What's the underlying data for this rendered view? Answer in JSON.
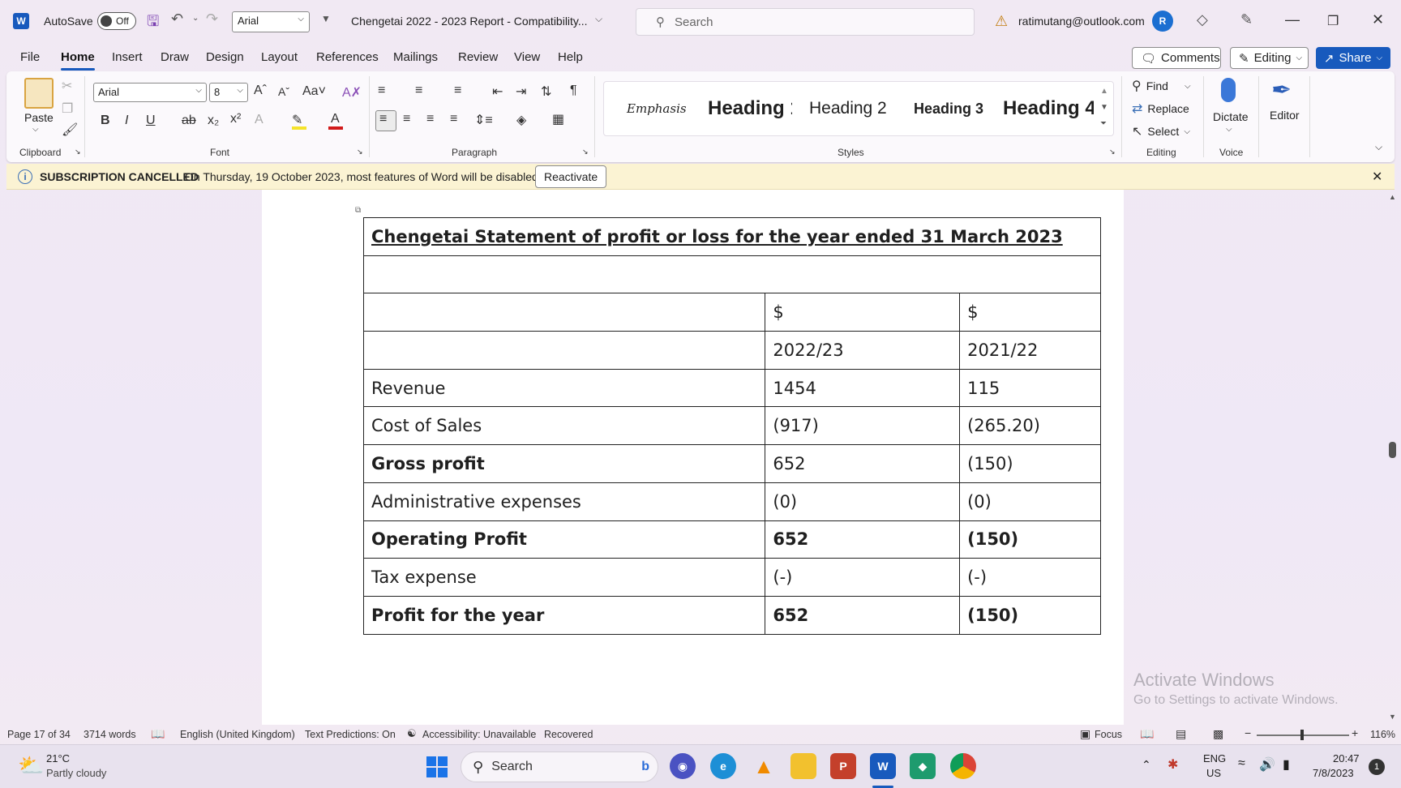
{
  "titlebar": {
    "app_letter": "W",
    "autosave_label": "AutoSave",
    "autosave_state": "Off",
    "font_name": "Arial",
    "document_title": "Chengetai 2022 - 2023 Report  -  Compatibility...",
    "search_placeholder": "Search",
    "account_email": "ratimutang@outlook.com",
    "avatar_initial": "R"
  },
  "tabs": [
    "File",
    "Home",
    "Insert",
    "Draw",
    "Design",
    "Layout",
    "References",
    "Mailings",
    "Review",
    "View",
    "Help"
  ],
  "tab_actions": {
    "comments": "Comments",
    "editing": "Editing",
    "share": "Share"
  },
  "ribbon": {
    "clipboard": {
      "paste": "Paste",
      "label": "Clipboard"
    },
    "font": {
      "family": "Arial",
      "size": "8",
      "label": "Font"
    },
    "paragraph": {
      "label": "Paragraph"
    },
    "styles": {
      "label": "Styles",
      "items": [
        "Emphasis",
        "Heading 1",
        "Heading 2",
        "Heading 3",
        "Heading 4"
      ]
    },
    "editing": {
      "find": "Find",
      "replace": "Replace",
      "select": "Select",
      "label": "Editing"
    },
    "voice": {
      "dictate": "Dictate",
      "label": "Voice"
    },
    "editor": {
      "label": "Editor"
    }
  },
  "notification": {
    "title": "SUBSCRIPTION CANCELLED",
    "message": "On Thursday, 19 October 2023, most features of Word will be disabled.",
    "action": "Reactivate"
  },
  "document": {
    "table_title": "Chengetai Statement of profit or loss for the year ended 31 March 2023",
    "rows": [
      {
        "label": "",
        "v1": "$",
        "v2": "$",
        "bold": false
      },
      {
        "label": "",
        "v1": "2022/23",
        "v2": "2021/22",
        "bold": false
      },
      {
        "label": "Revenue",
        "v1": "1454",
        "v2": "115",
        "bold": false
      },
      {
        "label": "Cost of Sales",
        "v1": "(917)",
        "v2": "(265.20)",
        "bold": false
      },
      {
        "label": "Gross profit",
        "v1": "652",
        "v2": "(150)",
        "bold": "label"
      },
      {
        "label": "Administrative expenses",
        "v1": "(0)",
        "v2": "(0)",
        "bold": false
      },
      {
        "label": "Operating Profit",
        "v1": "652",
        "v2": "(150)",
        "bold": true
      },
      {
        "label": "Tax expense",
        "v1": "(-)",
        "v2": "(-)",
        "bold": false
      },
      {
        "label": "Profit for the year",
        "v1": "652",
        "v2": "(150)",
        "bold": true
      }
    ]
  },
  "watermark": {
    "line1": "Activate Windows",
    "line2": "Go to Settings to activate Windows."
  },
  "statusbar": {
    "page": "Page 17 of 34",
    "words": "3714 words",
    "language": "English (United Kingdom)",
    "predictions": "Text Predictions: On",
    "accessibility": "Accessibility: Unavailable",
    "recovered": "Recovered",
    "focus": "Focus",
    "zoom": "116%"
  },
  "taskbar": {
    "weather_temp": "21°C",
    "weather_desc": "Partly cloudy",
    "search": "Search",
    "lang_1": "ENG",
    "lang_2": "US",
    "time": "20:47",
    "date": "7/8/2023",
    "notif_count": "1"
  },
  "colors": {
    "accent": "#185abd",
    "notif_bg": "#fbf3d3",
    "share_bg": "#185abd"
  }
}
